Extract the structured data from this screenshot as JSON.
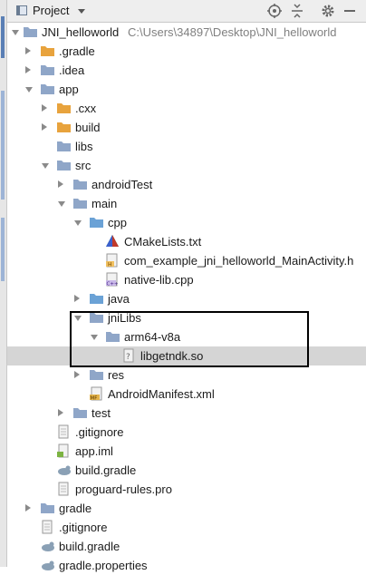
{
  "header": {
    "title": "Project",
    "icons": [
      "project-view-icon",
      "locate-icon",
      "collapse-all-icon",
      "settings-gear-icon",
      "hide-minus-icon"
    ]
  },
  "tree": {
    "root": {
      "name": "JNI_helloworld",
      "path": "C:\\Users\\34897\\Desktop\\JNI_helloworld"
    },
    "items": [
      {
        "label": ".gradle"
      },
      {
        "label": ".idea"
      },
      {
        "label": "app"
      },
      {
        "label": ".cxx"
      },
      {
        "label": "build"
      },
      {
        "label": "libs"
      },
      {
        "label": "src"
      },
      {
        "label": "androidTest"
      },
      {
        "label": "main"
      },
      {
        "label": "cpp"
      },
      {
        "label": "CMakeLists.txt"
      },
      {
        "label": "com_example_jni_helloworld_MainActivity.h"
      },
      {
        "label": "native-lib.cpp"
      },
      {
        "label": "java"
      },
      {
        "label": "jniLibs"
      },
      {
        "label": "arm64-v8a"
      },
      {
        "label": "libgetndk.so"
      },
      {
        "label": "res"
      },
      {
        "label": "AndroidManifest.xml"
      },
      {
        "label": "test"
      },
      {
        "label": ".gitignore"
      },
      {
        "label": "app.iml"
      },
      {
        "label": "build.gradle"
      },
      {
        "label": "proguard-rules.pro"
      },
      {
        "label": "gradle"
      },
      {
        "label": ".gitignore"
      },
      {
        "label": "build.gradle"
      },
      {
        "label": "gradle.properties"
      }
    ]
  },
  "colors": {
    "folder": "#8fa6c8",
    "excluded_folder": "#e8a33d",
    "source_folder": "#6ba2d6",
    "selection": "#d5d5d5",
    "highlight_border": "#000000"
  }
}
